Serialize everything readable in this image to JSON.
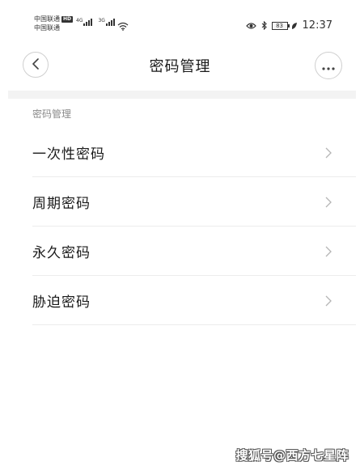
{
  "status_bar": {
    "carrier_1": "中国联通",
    "carrier_1_badge": "HD",
    "carrier_2": "中国联通",
    "network_1": "4G",
    "network_2": "3G",
    "battery": "83",
    "time": "12:37"
  },
  "title_bar": {
    "title": "密码管理"
  },
  "section": {
    "header": "密码管理",
    "items": [
      {
        "label": "一次性密码"
      },
      {
        "label": "周期密码"
      },
      {
        "label": "永久密码"
      },
      {
        "label": "胁迫密码"
      }
    ]
  },
  "watermark": "搜狐号@西方七星阵"
}
